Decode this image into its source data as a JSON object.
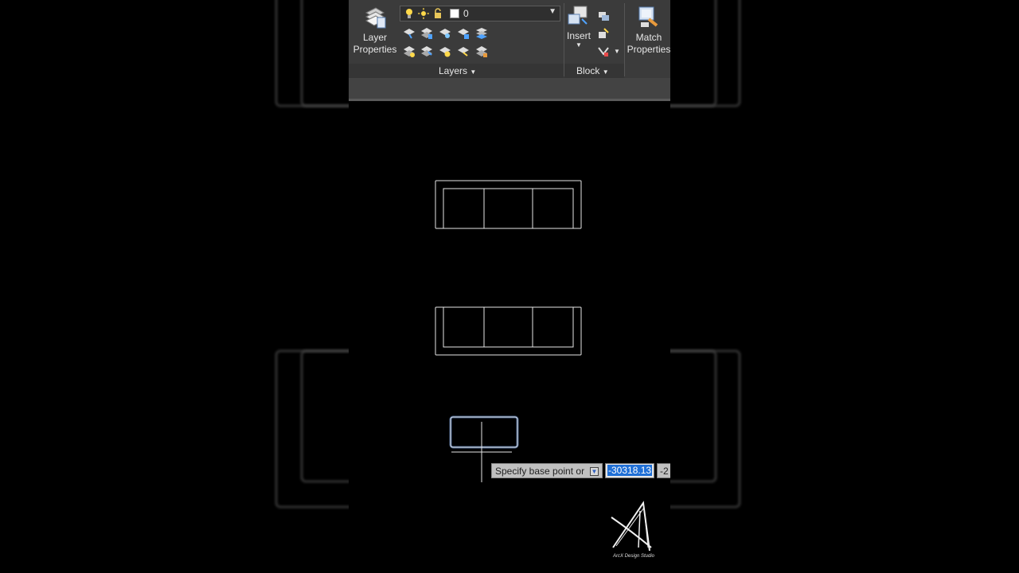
{
  "ribbon": {
    "layer_properties": {
      "line1": "Layer",
      "line2": "Properties"
    },
    "layer_dropdown": {
      "current_layer": "0"
    },
    "insert": {
      "label": "Insert"
    },
    "match_properties": {
      "line1": "Match",
      "line2": "Properties"
    },
    "panels": {
      "layers": "Layers",
      "block": "Block"
    }
  },
  "command": {
    "prompt": "Specify base point or",
    "x_value": "-30318.13",
    "y_value": "-2"
  },
  "watermark": {
    "text": "ArcX Design Studio"
  },
  "colors": {
    "ribbon_bg": "#3b3b3b",
    "highlight": "#1f6fd6",
    "selection": "#7fb0ff"
  }
}
